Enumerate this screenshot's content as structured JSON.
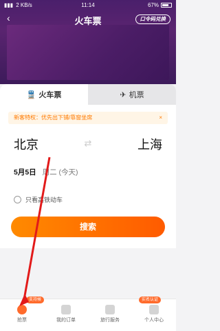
{
  "status": {
    "time": "11:14",
    "net": "2 KB/s",
    "battery": "67%"
  },
  "nav": {
    "title": "火车票",
    "redeem": "口令码兑换",
    "back_icon": "back-arrow-icon"
  },
  "tabs": [
    {
      "label": "火车票",
      "icon": "train-icon"
    },
    {
      "label": "机票",
      "icon": "plane-icon"
    }
  ],
  "notice": {
    "text": "新客特权：优先出下铺/靠窗坐席",
    "close": "×"
  },
  "route": {
    "from": "北京",
    "to": "上海",
    "swap_icon": "swap-icon"
  },
  "date": {
    "day": "5月5日",
    "week": "周二 (今天)"
  },
  "high_speed": {
    "label": "只看高铁动车"
  },
  "search": {
    "label": "搜索"
  },
  "bottom_nav": [
    {
      "label": "抢票",
      "badge": "支持候补",
      "icon": "lightning-icon"
    },
    {
      "label": "我的订单",
      "icon": "order-icon"
    },
    {
      "label": "旅行服务",
      "icon": "grid-icon"
    },
    {
      "label": "个人中心",
      "badge": "实名认证",
      "icon": "user-icon"
    }
  ],
  "colors": {
    "header": "#4a1f6b",
    "accent": "#ff6b2c",
    "notice": "#ff7a00"
  }
}
